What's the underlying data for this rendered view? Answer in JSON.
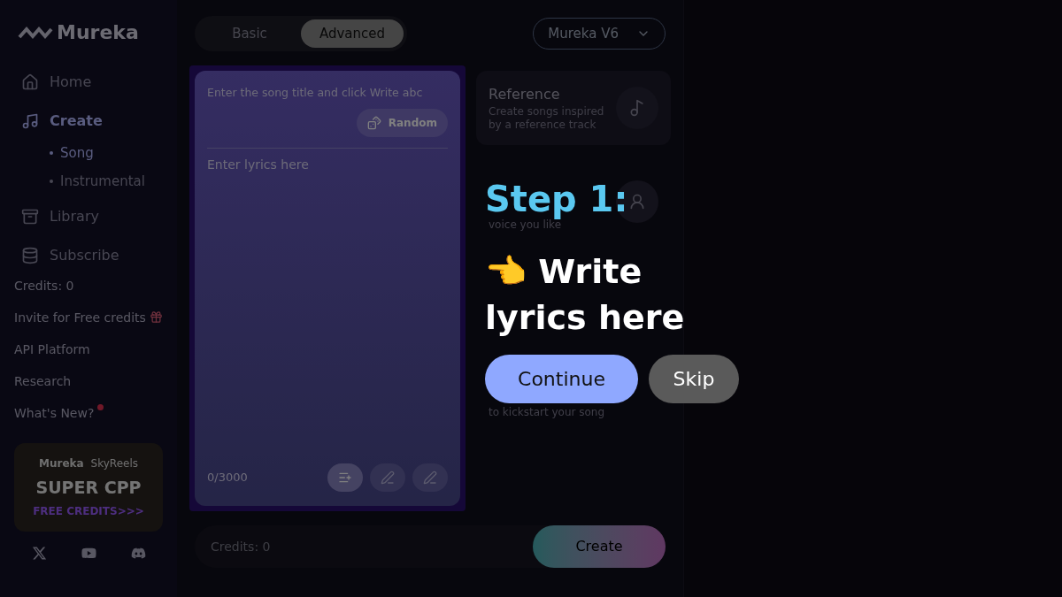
{
  "sidebar": {
    "logo": "Mureka",
    "nav": [
      {
        "label": "Home",
        "selected": false
      },
      {
        "label": "Create",
        "selected": true,
        "children": [
          {
            "label": "Song",
            "selected": true
          },
          {
            "label": "Instrumental",
            "selected": false
          }
        ]
      },
      {
        "label": "Library",
        "selected": false
      },
      {
        "label": "Subscribe",
        "selected": false
      }
    ],
    "links": [
      {
        "label": "Credits: 0",
        "kind": "plain"
      },
      {
        "label": "Invite for Free credits",
        "kind": "gift"
      },
      {
        "label": "API Platform",
        "kind": "plain"
      },
      {
        "label": "Research",
        "kind": "plain"
      },
      {
        "label": "What's New?",
        "kind": "dot"
      }
    ],
    "promo": {
      "brand_1": "Mureka",
      "brand_2": "SkyReels",
      "headline": "SUPER CPP",
      "cta": "FREE CREDITS>>>"
    }
  },
  "mode_tabs": [
    {
      "label": "Basic",
      "selected": false
    },
    {
      "label": "Advanced",
      "selected": true
    }
  ],
  "model_select": {
    "value": "Mureka V6"
  },
  "lyrics": {
    "title_placeholder": "Enter the song title and click Write abc",
    "random_button": "Random",
    "lyrics_placeholder": "Enter lyrics here",
    "counter": "0/3000",
    "tools": [
      {
        "selected": true
      },
      {
        "selected": false
      },
      {
        "selected": false
      }
    ]
  },
  "cards": [
    {
      "kind": "full",
      "title": "Reference",
      "description": "Create songs inspired by a reference track"
    },
    {
      "kind": "partial",
      "description": "voice you like"
    },
    {
      "kind": "hidden"
    },
    {
      "kind": "partial",
      "description": "to kickstart your song"
    }
  ],
  "create_bar": {
    "credits": "Credits: 0",
    "button": "Create"
  },
  "tour": {
    "step": "Step 1:",
    "emoji": "👈",
    "message": "Write lyrics here",
    "continue": "Continue",
    "skip": "Skip"
  }
}
